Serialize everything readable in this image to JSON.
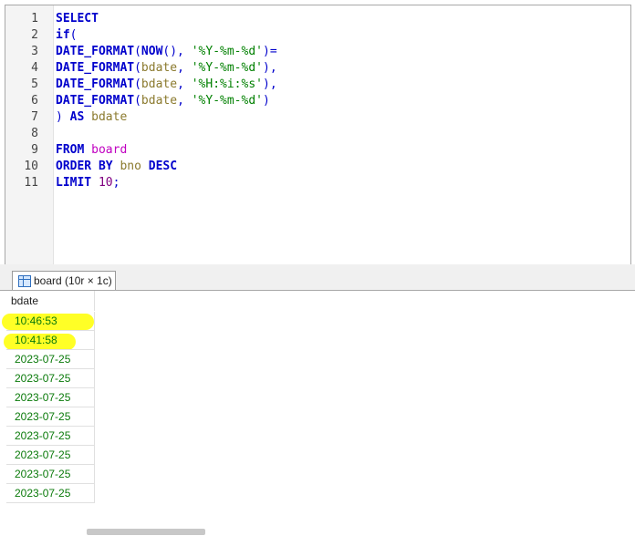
{
  "editor": {
    "lines": [
      {
        "n": "1",
        "tokens": [
          {
            "t": "SELECT",
            "c": "kw"
          }
        ]
      },
      {
        "n": "2",
        "tokens": [
          {
            "t": "if",
            "c": "kw"
          },
          {
            "t": "(",
            "c": "pn"
          }
        ]
      },
      {
        "n": "3",
        "tokens": [
          {
            "t": "DATE_FORMAT",
            "c": "fn"
          },
          {
            "t": "(",
            "c": "pn"
          },
          {
            "t": "NOW",
            "c": "fn"
          },
          {
            "t": "(), ",
            "c": "pn"
          },
          {
            "t": "'%Y-%m-%d'",
            "c": "str"
          },
          {
            "t": ")=",
            "c": "op"
          }
        ]
      },
      {
        "n": "4",
        "tokens": [
          {
            "t": "DATE_FORMAT",
            "c": "fn"
          },
          {
            "t": "(",
            "c": "pn"
          },
          {
            "t": "bdate",
            "c": "id"
          },
          {
            "t": ", ",
            "c": "pn"
          },
          {
            "t": "'%Y-%m-%d'",
            "c": "str"
          },
          {
            "t": "),",
            "c": "pn"
          }
        ]
      },
      {
        "n": "5",
        "tokens": [
          {
            "t": "DATE_FORMAT",
            "c": "fn"
          },
          {
            "t": "(",
            "c": "pn"
          },
          {
            "t": "bdate",
            "c": "id"
          },
          {
            "t": ", ",
            "c": "pn"
          },
          {
            "t": "'%H:%i:%s'",
            "c": "str"
          },
          {
            "t": "),",
            "c": "pn"
          }
        ]
      },
      {
        "n": "6",
        "tokens": [
          {
            "t": "DATE_FORMAT",
            "c": "fn"
          },
          {
            "t": "(",
            "c": "pn"
          },
          {
            "t": "bdate",
            "c": "id"
          },
          {
            "t": ", ",
            "c": "pn"
          },
          {
            "t": "'%Y-%m-%d'",
            "c": "str"
          },
          {
            "t": ")",
            "c": "pn"
          }
        ]
      },
      {
        "n": "7",
        "tokens": [
          {
            "t": ") ",
            "c": "pn"
          },
          {
            "t": "AS",
            "c": "kw"
          },
          {
            "t": " ",
            "c": "pn"
          },
          {
            "t": "bdate",
            "c": "id"
          }
        ]
      },
      {
        "n": "8",
        "tokens": []
      },
      {
        "n": "9",
        "tokens": [
          {
            "t": "FROM",
            "c": "kw"
          },
          {
            "t": " ",
            "c": "pn"
          },
          {
            "t": "board",
            "c": "tbl"
          }
        ]
      },
      {
        "n": "10",
        "tokens": [
          {
            "t": "ORDER BY",
            "c": "kw"
          },
          {
            "t": " ",
            "c": "pn"
          },
          {
            "t": "bno",
            "c": "id"
          },
          {
            "t": " ",
            "c": "pn"
          },
          {
            "t": "DESC",
            "c": "kw"
          }
        ]
      },
      {
        "n": "11",
        "tokens": [
          {
            "t": "LIMIT",
            "c": "kw"
          },
          {
            "t": " ",
            "c": "pn"
          },
          {
            "t": "10",
            "c": "num"
          },
          {
            "t": ";",
            "c": "pn"
          }
        ]
      }
    ]
  },
  "results_tab": {
    "icon": "table-grid-icon",
    "label": "board (10r × 1c)"
  },
  "result_grid": {
    "column": "bdate",
    "rows": [
      "10:46:53",
      "10:41:58",
      "2023-07-25",
      "2023-07-25",
      "2023-07-25",
      "2023-07-25",
      "2023-07-25",
      "2023-07-25",
      "2023-07-25",
      "2023-07-25"
    ],
    "highlighted_rows": [
      0,
      1
    ],
    "highlight_color": "#ffff00"
  }
}
